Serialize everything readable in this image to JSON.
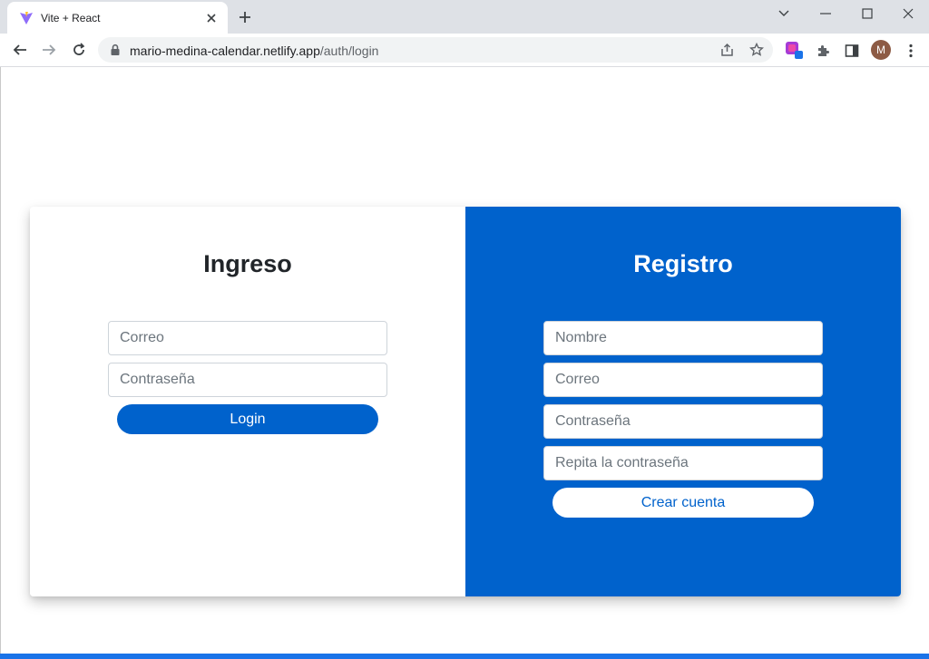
{
  "browser": {
    "tab_title": "Vite + React",
    "url_domain": "mario-medina-calendar.netlify.app",
    "url_path": "/auth/login",
    "profile_initial": "M"
  },
  "login": {
    "title": "Ingreso",
    "email_placeholder": "Correo",
    "password_placeholder": "Contraseña",
    "submit_label": "Login"
  },
  "register": {
    "title": "Registro",
    "name_placeholder": "Nombre",
    "email_placeholder": "Correo",
    "password_placeholder": "Contraseña",
    "password2_placeholder": "Repita la contraseña",
    "submit_label": "Crear cuenta"
  },
  "colors": {
    "primary": "#0062cc",
    "tabstrip": "#dee1e6",
    "omnibox": "#f1f3f4"
  }
}
